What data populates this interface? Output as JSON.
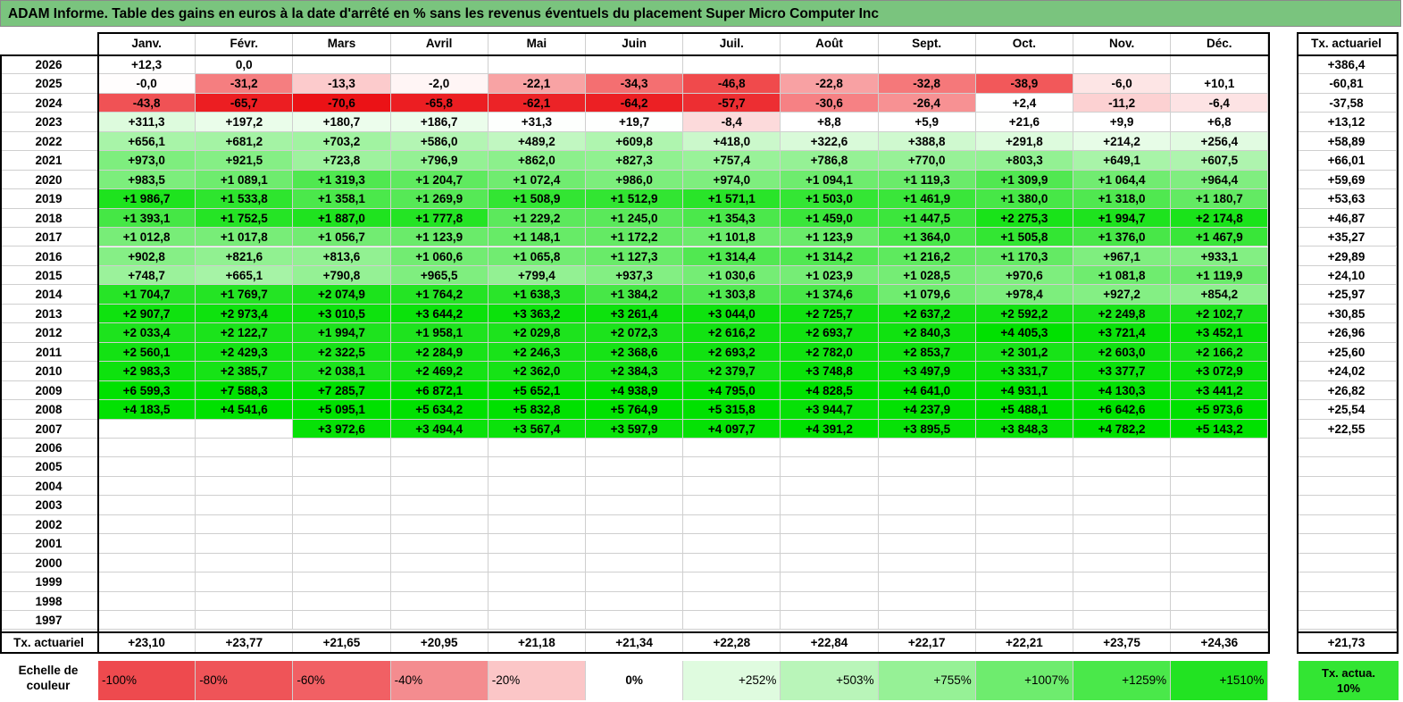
{
  "title": "ADAM Informe. Table des gains en euros à la date d'arrêté en % sans les revenus éventuels du placement Super Micro Computer Inc",
  "months": [
    "Janv.",
    "Févr.",
    "Mars",
    "Avril",
    "Mai",
    "Juin",
    "Juil.",
    "Août",
    "Sept.",
    "Oct.",
    "Nov.",
    "Déc."
  ],
  "tx_header": "Tx. actuariel",
  "rows": [
    {
      "year": "2026",
      "values": [
        "+12,3",
        "0,0",
        "",
        "",
        "",
        "",
        "",
        "",
        "",
        "",
        "",
        ""
      ],
      "colors": [
        "#ffffff",
        "#ffffff",
        "#ffffff",
        "#ffffff",
        "#ffffff",
        "#ffffff",
        "#ffffff",
        "#ffffff",
        "#ffffff",
        "#ffffff",
        "#ffffff",
        "#ffffff"
      ],
      "tx": "+386,4"
    },
    {
      "year": "2025",
      "values": [
        "-0,0",
        "-31,2",
        "-13,3",
        "-2,0",
        "-22,1",
        "-34,3",
        "-46,8",
        "-22,8",
        "-32,8",
        "-38,9",
        "-6,0",
        "+10,1"
      ],
      "colors": [
        "#fffdfd",
        "#f57e80",
        "#fccbcc",
        "#fff5f5",
        "#f8a3a4",
        "#f46f71",
        "#f04a4c",
        "#f8a1a3",
        "#f5787a",
        "#f2585a",
        "#fde5e5",
        "#ffffff"
      ],
      "tx": "-60,81"
    },
    {
      "year": "2024",
      "values": [
        "-43,8",
        "-65,7",
        "-70,6",
        "-65,8",
        "-62,1",
        "-64,2",
        "-57,7",
        "-30,6",
        "-26,4",
        "+2,4",
        "-11,2",
        "-6,4"
      ],
      "colors": [
        "#f05255",
        "#ec1e22",
        "#eb1216",
        "#ec1e22",
        "#ec2327",
        "#ec2024",
        "#ed2e32",
        "#f68184",
        "#f79193",
        "#ffffff",
        "#fcd1d2",
        "#fde3e4"
      ],
      "tx": "-37,58"
    },
    {
      "year": "2023",
      "values": [
        "+311,3",
        "+197,2",
        "+180,7",
        "+186,7",
        "+31,3",
        "+19,7",
        "-8,4",
        "+8,8",
        "+5,9",
        "+21,6",
        "+9,9",
        "+6,8"
      ],
      "colors": [
        "#ddfbdd",
        "#eafdea",
        "#ecfdec",
        "#ebfdeb",
        "#fdfffd",
        "#fefffe",
        "#fcdadb",
        "#ffffff",
        "#ffffff",
        "#fefffe",
        "#ffffff",
        "#ffffff"
      ],
      "tx": "+13,12"
    },
    {
      "year": "2022",
      "values": [
        "+656,1",
        "+681,2",
        "+703,2",
        "+586,0",
        "+489,2",
        "+609,8",
        "+418,0",
        "+322,6",
        "+388,8",
        "+291,8",
        "+214,2",
        "+256,4"
      ],
      "colors": [
        "#a8f4a8",
        "#a4f3a4",
        "#a1f3a1",
        "#b3f5b3",
        "#c1f7c1",
        "#aff5af",
        "#cbf8cb",
        "#d9fad9",
        "#cff9cf",
        "#ddfbdd",
        "#e7fce7",
        "#e1fbe1"
      ],
      "tx": "+58,89"
    },
    {
      "year": "2021",
      "values": [
        "+973,0",
        "+921,5",
        "+723,8",
        "+796,9",
        "+862,0",
        "+827,3",
        "+757,4",
        "+786,8",
        "+770,0",
        "+803,3",
        "+649,1",
        "+607,5"
      ],
      "colors": [
        "#7eee7e",
        "#85ef85",
        "#9ef29e",
        "#94f194",
        "#8cf08c",
        "#90f190",
        "#99f299",
        "#95f195",
        "#97f197",
        "#93f193",
        "#a8f4a8",
        "#aef4ae"
      ],
      "tx": "+66,01"
    },
    {
      "year": "2020",
      "values": [
        "+983,5",
        "+1 089,1",
        "+1 319,3",
        "+1 204,7",
        "+1 072,4",
        "+986,0",
        "+974,0",
        "+1 094,1",
        "+1 119,3",
        "+1 309,9",
        "+1 064,4",
        "+964,4"
      ],
      "colors": [
        "#7cee7c",
        "#6eec6e",
        "#50e850",
        "#5fea5f",
        "#70ec70",
        "#7cee7c",
        "#7eee7e",
        "#6eec6e",
        "#6aeb6a",
        "#51e851",
        "#71ec71",
        "#80ee80"
      ],
      "tx": "+59,69"
    },
    {
      "year": "2019",
      "values": [
        "+1 986,7",
        "+1 533,8",
        "+1 358,1",
        "+1 269,9",
        "+1 508,9",
        "+1 512,9",
        "+1 571,1",
        "+1 503,0",
        "+1 461,9",
        "+1 380,0",
        "+1 318,0",
        "+1 180,7"
      ],
      "colors": [
        "#1ee31e",
        "#2ee52e",
        "#4be84b",
        "#56e956",
        "#33e533",
        "#32e532",
        "#29e429",
        "#34e634",
        "#3ae63a",
        "#47e747",
        "#50e850",
        "#63ea63"
      ],
      "tx": "+53,63"
    },
    {
      "year": "2018",
      "values": [
        "+1 393,1",
        "+1 752,5",
        "+1 887,0",
        "+1 777,8",
        "+1 229,2",
        "+1 245,0",
        "+1 354,3",
        "+1 459,0",
        "+1 447,5",
        "+2 275,3",
        "+1 994,7",
        "+2 174,8"
      ],
      "colors": [
        "#45e745",
        "#25e425",
        "#1fe31f",
        "#24e424",
        "#5ce95c",
        "#5ae95a",
        "#4be84b",
        "#3ae63a",
        "#3ce63c",
        "#19e319",
        "#1ee31e",
        "#1ae31a"
      ],
      "tx": "+46,87"
    },
    {
      "year": "2017",
      "values": [
        "+1 012,8",
        "+1 017,8",
        "+1 056,7",
        "+1 123,9",
        "+1 148,1",
        "+1 172,2",
        "+1 101,8",
        "+1 123,9",
        "+1 364,0",
        "+1 505,8",
        "+1 376,0",
        "+1 467,9"
      ],
      "colors": [
        "#78ed78",
        "#78ed78",
        "#72ec72",
        "#6aeb6a",
        "#67eb67",
        "#64ea64",
        "#6cec6c",
        "#6aeb6a",
        "#4ae84a",
        "#33e633",
        "#48e748",
        "#39e639"
      ],
      "tx": "+35,27"
    },
    {
      "year": "2016",
      "values": [
        "+902,8",
        "+821,6",
        "+813,6",
        "+1 060,6",
        "+1 065,8",
        "+1 127,3",
        "+1 314,4",
        "+1 314,2",
        "+1 216,2",
        "+1 170,3",
        "+967,1",
        "+933,1"
      ],
      "colors": [
        "#86ef86",
        "#91f191",
        "#92f192",
        "#72ec72",
        "#71ec71",
        "#69eb69",
        "#51e851",
        "#51e851",
        "#5eea5e",
        "#64ea64",
        "#7fee7f",
        "#83ef83"
      ],
      "tx": "+29,89"
    },
    {
      "year": "2015",
      "values": [
        "+748,7",
        "+665,1",
        "+790,8",
        "+965,5",
        "+799,4",
        "+937,3",
        "+1 030,6",
        "+1 023,9",
        "+1 028,5",
        "+970,6",
        "+1 081,8",
        "+1 119,9"
      ],
      "colors": [
        "#9bf29b",
        "#a6f3a6",
        "#95f195",
        "#7fee7f",
        "#93f193",
        "#83ef83",
        "#75ed75",
        "#76ed76",
        "#75ed75",
        "#7eee7e",
        "#6fec6f",
        "#6aeb6a"
      ],
      "tx": "+24,10"
    },
    {
      "year": "2014",
      "values": [
        "+1 704,7",
        "+1 769,7",
        "+2 074,9",
        "+1 764,2",
        "+1 638,3",
        "+1 384,2",
        "+1 303,8",
        "+1 374,6",
        "+1 079,6",
        "+978,4",
        "+927,2",
        "+854,2"
      ],
      "colors": [
        "#27e427",
        "#24e424",
        "#1ce31c",
        "#24e424",
        "#2ae52a",
        "#47e747",
        "#52e852",
        "#48e748",
        "#70ec70",
        "#7dee7d",
        "#84ef84",
        "#8df08d"
      ],
      "tx": "+25,97"
    },
    {
      "year": "2013",
      "values": [
        "+2 907,7",
        "+2 973,4",
        "+3 010,5",
        "+3 644,2",
        "+3 363,2",
        "+3 261,4",
        "+3 044,0",
        "+2 725,7",
        "+2 637,2",
        "+2 592,2",
        "+2 249,8",
        "+2 102,7"
      ],
      "colors": [
        "#0fe20f",
        "#0ee20e",
        "#0ee20e",
        "#0be20b",
        "#0ce20c",
        "#0de20d",
        "#0ee20e",
        "#11e211",
        "#12e212",
        "#13e213",
        "#19e319",
        "#1be31b"
      ],
      "tx": "+30,85"
    },
    {
      "year": "2012",
      "values": [
        "+2 033,4",
        "+2 122,7",
        "+1 994,7",
        "+1 958,1",
        "+2 029,8",
        "+2 072,3",
        "+2 616,2",
        "+2 693,7",
        "+2 840,3",
        "+4 405,3",
        "+3 721,4",
        "+3 452,1"
      ],
      "colors": [
        "#1de31d",
        "#1be31b",
        "#1ee31e",
        "#1ee31e",
        "#1de31d",
        "#1ce31c",
        "#12e212",
        "#11e211",
        "#10e210",
        "#00e100",
        "#0ae20a",
        "#0ce20c"
      ],
      "tx": "+26,96"
    },
    {
      "year": "2011",
      "values": [
        "+2 560,1",
        "+2 429,3",
        "+2 322,5",
        "+2 284,9",
        "+2 246,3",
        "+2 368,6",
        "+2 693,2",
        "+2 782,0",
        "+2 853,7",
        "+2 301,2",
        "+2 603,0",
        "+2 166,2"
      ],
      "colors": [
        "#13e213",
        "#15e315",
        "#18e318",
        "#18e318",
        "#19e319",
        "#16e316",
        "#11e211",
        "#10e210",
        "#10e210",
        "#18e318",
        "#12e212",
        "#1ae31a"
      ],
      "tx": "+25,60"
    },
    {
      "year": "2010",
      "values": [
        "+2 983,3",
        "+2 385,7",
        "+2 038,1",
        "+2 469,2",
        "+2 362,0",
        "+2 384,3",
        "+2 379,7",
        "+3 748,8",
        "+3 497,9",
        "+3 331,7",
        "+3 377,7",
        "+3 072,9"
      ],
      "colors": [
        "#0ee20e",
        "#16e316",
        "#1de31d",
        "#15e315",
        "#16e316",
        "#16e316",
        "#16e316",
        "#0ae20a",
        "#0be20b",
        "#0ce20c",
        "#0ce20c",
        "#0ee20e"
      ],
      "tx": "+24,02"
    },
    {
      "year": "2009",
      "values": [
        "+6 599,3",
        "+7 588,3",
        "+7 285,7",
        "+6 872,1",
        "+5 652,1",
        "+4 938,9",
        "+4 795,0",
        "+4 828,5",
        "+4 641,0",
        "+4 931,1",
        "+4 130,3",
        "+3 441,2"
      ],
      "colors": [
        "#00e100",
        "#00e100",
        "#00e100",
        "#00e100",
        "#00e100",
        "#00e100",
        "#00e100",
        "#00e100",
        "#00e100",
        "#00e100",
        "#04e104",
        "#0ce20c"
      ],
      "tx": "+26,82"
    },
    {
      "year": "2008",
      "values": [
        "+4 183,5",
        "+4 541,6",
        "+5 095,1",
        "+5 634,2",
        "+5 832,8",
        "+5 764,9",
        "+5 315,8",
        "+3 944,7",
        "+4 237,9",
        "+5 488,1",
        "+6 642,6",
        "+5 973,6"
      ],
      "colors": [
        "#03e103",
        "#00e100",
        "#00e100",
        "#00e100",
        "#00e100",
        "#00e100",
        "#00e100",
        "#07e107",
        "#03e103",
        "#00e100",
        "#00e100",
        "#00e100"
      ],
      "tx": "+25,54"
    },
    {
      "year": "2007",
      "values": [
        "",
        "",
        "+3 972,6",
        "+3 494,4",
        "+3 567,4",
        "+3 597,9",
        "+4 097,7",
        "+4 391,2",
        "+3 895,5",
        "+3 848,3",
        "+4 782,2",
        "+5 143,2"
      ],
      "colors": [
        "#ffffff",
        "#ffffff",
        "#07e107",
        "#0be20b",
        "#0be20b",
        "#0ae20a",
        "#05e105",
        "#01e101",
        "#07e107",
        "#08e108",
        "#00e100",
        "#00e100"
      ],
      "tx": "+22,55"
    },
    {
      "year": "2006",
      "values": [
        "",
        "",
        "",
        "",
        "",
        "",
        "",
        "",
        "",
        "",
        "",
        ""
      ],
      "colors": [
        "#ffffff",
        "#ffffff",
        "#ffffff",
        "#ffffff",
        "#ffffff",
        "#ffffff",
        "#ffffff",
        "#ffffff",
        "#ffffff",
        "#ffffff",
        "#ffffff",
        "#ffffff"
      ],
      "tx": ""
    },
    {
      "year": "2005",
      "values": [
        "",
        "",
        "",
        "",
        "",
        "",
        "",
        "",
        "",
        "",
        "",
        ""
      ],
      "colors": [
        "#ffffff",
        "#ffffff",
        "#ffffff",
        "#ffffff",
        "#ffffff",
        "#ffffff",
        "#ffffff",
        "#ffffff",
        "#ffffff",
        "#ffffff",
        "#ffffff",
        "#ffffff"
      ],
      "tx": ""
    },
    {
      "year": "2004",
      "values": [
        "",
        "",
        "",
        "",
        "",
        "",
        "",
        "",
        "",
        "",
        "",
        ""
      ],
      "colors": [
        "#ffffff",
        "#ffffff",
        "#ffffff",
        "#ffffff",
        "#ffffff",
        "#ffffff",
        "#ffffff",
        "#ffffff",
        "#ffffff",
        "#ffffff",
        "#ffffff",
        "#ffffff"
      ],
      "tx": ""
    },
    {
      "year": "2003",
      "values": [
        "",
        "",
        "",
        "",
        "",
        "",
        "",
        "",
        "",
        "",
        "",
        ""
      ],
      "colors": [
        "#ffffff",
        "#ffffff",
        "#ffffff",
        "#ffffff",
        "#ffffff",
        "#ffffff",
        "#ffffff",
        "#ffffff",
        "#ffffff",
        "#ffffff",
        "#ffffff",
        "#ffffff"
      ],
      "tx": ""
    },
    {
      "year": "2002",
      "values": [
        "",
        "",
        "",
        "",
        "",
        "",
        "",
        "",
        "",
        "",
        "",
        ""
      ],
      "colors": [
        "#ffffff",
        "#ffffff",
        "#ffffff",
        "#ffffff",
        "#ffffff",
        "#ffffff",
        "#ffffff",
        "#ffffff",
        "#ffffff",
        "#ffffff",
        "#ffffff",
        "#ffffff"
      ],
      "tx": ""
    },
    {
      "year": "2001",
      "values": [
        "",
        "",
        "",
        "",
        "",
        "",
        "",
        "",
        "",
        "",
        "",
        ""
      ],
      "colors": [
        "#ffffff",
        "#ffffff",
        "#ffffff",
        "#ffffff",
        "#ffffff",
        "#ffffff",
        "#ffffff",
        "#ffffff",
        "#ffffff",
        "#ffffff",
        "#ffffff",
        "#ffffff"
      ],
      "tx": ""
    },
    {
      "year": "2000",
      "values": [
        "",
        "",
        "",
        "",
        "",
        "",
        "",
        "",
        "",
        "",
        "",
        ""
      ],
      "colors": [
        "#ffffff",
        "#ffffff",
        "#ffffff",
        "#ffffff",
        "#ffffff",
        "#ffffff",
        "#ffffff",
        "#ffffff",
        "#ffffff",
        "#ffffff",
        "#ffffff",
        "#ffffff"
      ],
      "tx": ""
    },
    {
      "year": "1999",
      "values": [
        "",
        "",
        "",
        "",
        "",
        "",
        "",
        "",
        "",
        "",
        "",
        ""
      ],
      "colors": [
        "#ffffff",
        "#ffffff",
        "#ffffff",
        "#ffffff",
        "#ffffff",
        "#ffffff",
        "#ffffff",
        "#ffffff",
        "#ffffff",
        "#ffffff",
        "#ffffff",
        "#ffffff"
      ],
      "tx": ""
    },
    {
      "year": "1998",
      "values": [
        "",
        "",
        "",
        "",
        "",
        "",
        "",
        "",
        "",
        "",
        "",
        ""
      ],
      "colors": [
        "#ffffff",
        "#ffffff",
        "#ffffff",
        "#ffffff",
        "#ffffff",
        "#ffffff",
        "#ffffff",
        "#ffffff",
        "#ffffff",
        "#ffffff",
        "#ffffff",
        "#ffffff"
      ],
      "tx": ""
    },
    {
      "year": "1997",
      "values": [
        "",
        "",
        "",
        "",
        "",
        "",
        "",
        "",
        "",
        "",
        "",
        ""
      ],
      "colors": [
        "#ffffff",
        "#ffffff",
        "#ffffff",
        "#ffffff",
        "#ffffff",
        "#ffffff",
        "#ffffff",
        "#ffffff",
        "#ffffff",
        "#ffffff",
        "#ffffff",
        "#ffffff"
      ],
      "tx": ""
    }
  ],
  "footer": {
    "label": "Tx. actuariel",
    "values": [
      "+23,10",
      "+23,77",
      "+21,65",
      "+20,95",
      "+21,18",
      "+21,34",
      "+22,28",
      "+22,84",
      "+22,17",
      "+22,21",
      "+23,75",
      "+24,36"
    ],
    "tx": "+21,73"
  },
  "legend": {
    "label": "Echelle de couleur",
    "items": [
      {
        "text": "-100%",
        "color": "#ee4a4e",
        "align": "left"
      },
      {
        "text": "-80%",
        "color": "#ef5458",
        "align": "left"
      },
      {
        "text": "-60%",
        "color": "#f16064",
        "align": "left"
      },
      {
        "text": "-40%",
        "color": "#f48c8f",
        "align": "left"
      },
      {
        "text": "-20%",
        "color": "#fbc6c7",
        "align": "left"
      },
      {
        "text": "0%",
        "color": "#ffffff",
        "align": "center"
      },
      {
        "text": "+252%",
        "color": "#dffbdf",
        "align": "right"
      },
      {
        "text": "+503%",
        "color": "#b9f5b9",
        "align": "right"
      },
      {
        "text": "+755%",
        "color": "#96f196",
        "align": "right"
      },
      {
        "text": "+1007%",
        "color": "#6eec6e",
        "align": "right"
      },
      {
        "text": "+1259%",
        "color": "#4ae84a",
        "align": "right"
      },
      {
        "text": "+1510%",
        "color": "#22e322",
        "align": "right"
      }
    ],
    "tx_label": "Tx. actua. 10%",
    "tx_color": "#33e533"
  }
}
